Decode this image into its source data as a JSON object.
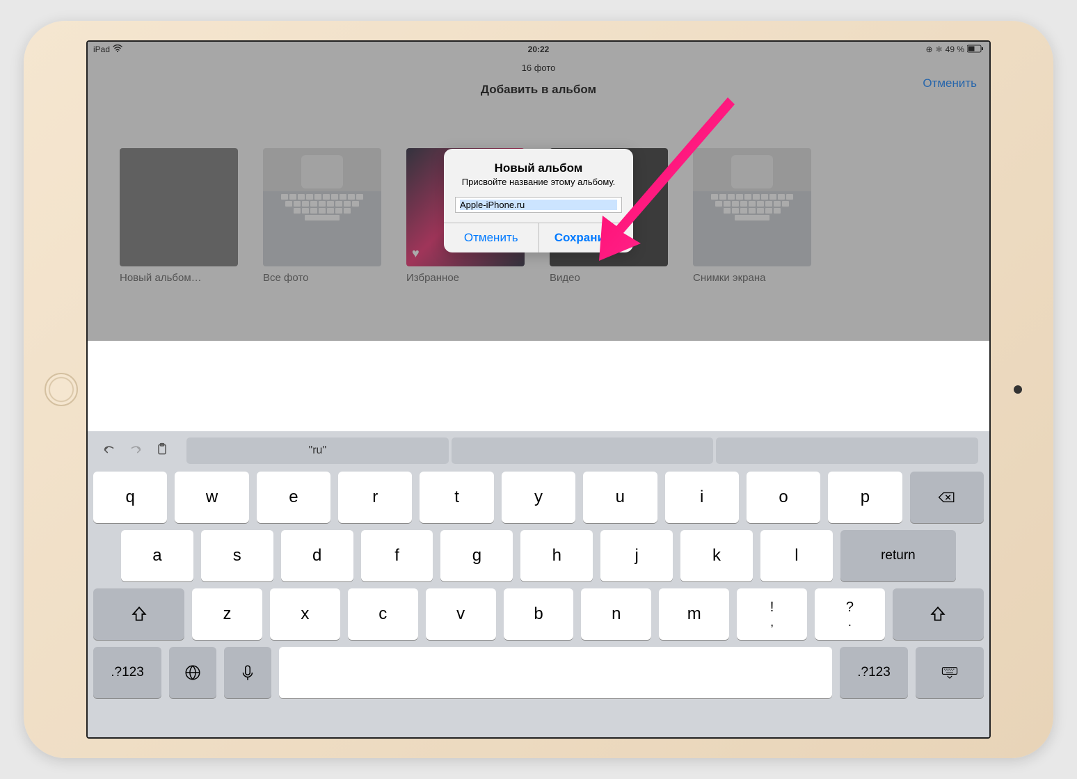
{
  "status": {
    "device": "iPad",
    "time": "20:22",
    "battery": "49 %"
  },
  "header": {
    "count": "16 фото",
    "title": "Добавить в альбом",
    "cancel": "Отменить"
  },
  "albums": [
    {
      "label": "Новый альбом…"
    },
    {
      "label": "Все фото"
    },
    {
      "label": "Избранное"
    },
    {
      "label": "Видео"
    },
    {
      "label": "Снимки экрана"
    }
  ],
  "alert": {
    "title": "Новый альбом",
    "message": "Присвойте название этому альбому.",
    "input": "Apple-iPhone.ru",
    "cancel": "Отменить",
    "save": "Сохранить"
  },
  "keyboard": {
    "suggestion": "\"ru\"",
    "rows": {
      "r1": [
        "q",
        "w",
        "e",
        "r",
        "t",
        "y",
        "u",
        "i",
        "o",
        "p"
      ],
      "r2": [
        "a",
        "s",
        "d",
        "f",
        "g",
        "h",
        "j",
        "k",
        "l"
      ],
      "r3": [
        "z",
        "x",
        "c",
        "v",
        "b",
        "n",
        "m"
      ],
      "punct1": {
        "top": "!",
        "bot": ","
      },
      "punct2": {
        "top": "?",
        "bot": "."
      }
    },
    "return": "return",
    "num": ".?123"
  }
}
